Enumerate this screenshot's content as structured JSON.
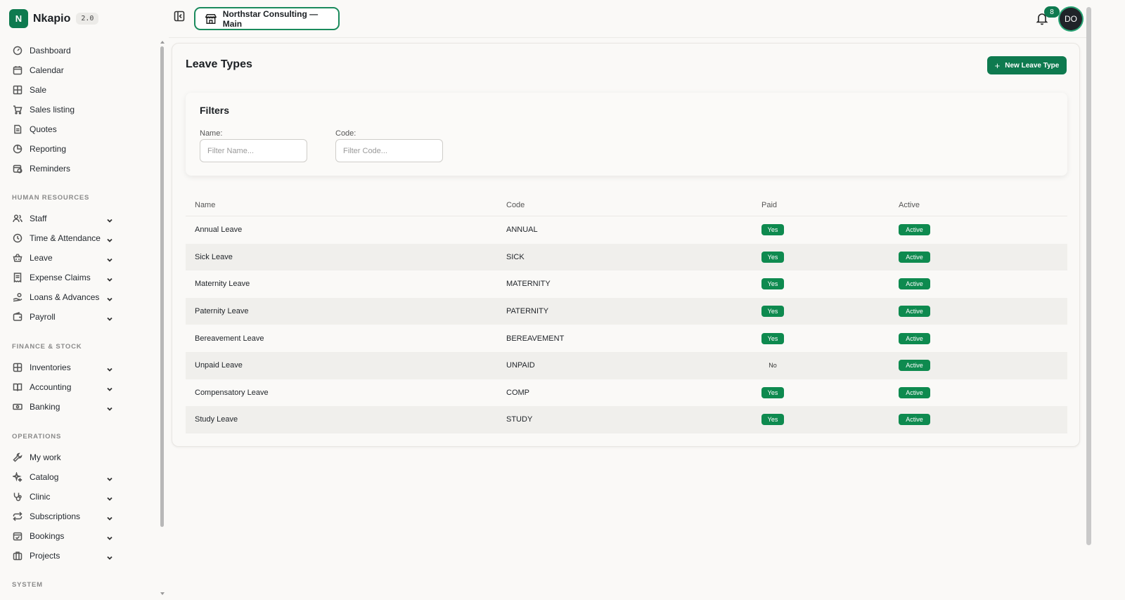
{
  "brand": {
    "logo_letter": "N",
    "name": "Nkapio",
    "version": "2.0"
  },
  "sidebar": {
    "top_items": [
      {
        "label": "Dashboard",
        "icon": "gauge-icon"
      },
      {
        "label": "Calendar",
        "icon": "calendar-icon"
      },
      {
        "label": "Sale",
        "icon": "grid-icon"
      },
      {
        "label": "Sales listing",
        "icon": "cart-icon"
      },
      {
        "label": "Quotes",
        "icon": "document-icon"
      },
      {
        "label": "Reporting",
        "icon": "pie-chart-icon"
      },
      {
        "label": "Reminders",
        "icon": "calendar-clock-icon"
      }
    ],
    "sections": [
      {
        "title": "HUMAN RESOURCES",
        "items": [
          {
            "label": "Staff",
            "icon": "users-icon"
          },
          {
            "label": "Time & Attendance",
            "icon": "clock-icon"
          },
          {
            "label": "Leave",
            "icon": "basket-icon"
          },
          {
            "label": "Expense Claims",
            "icon": "receipt-icon"
          },
          {
            "label": "Loans & Advances",
            "icon": "hand-coins-icon"
          },
          {
            "label": "Payroll",
            "icon": "wallet-icon"
          }
        ]
      },
      {
        "title": "FINANCE & STOCK",
        "items": [
          {
            "label": "Inventories",
            "icon": "box-icon"
          },
          {
            "label": "Accounting",
            "icon": "book-icon"
          },
          {
            "label": "Banking",
            "icon": "banknote-icon"
          }
        ]
      },
      {
        "title": "OPERATIONS",
        "items": [
          {
            "label": "My work",
            "icon": "wrench-icon"
          },
          {
            "label": "Catalog",
            "icon": "sparkles-icon"
          },
          {
            "label": "Clinic",
            "icon": "stethoscope-icon"
          },
          {
            "label": "Subscriptions",
            "icon": "repeat-icon"
          },
          {
            "label": "Bookings",
            "icon": "calendar-check-icon"
          },
          {
            "label": "Projects",
            "icon": "briefcase-icon"
          }
        ]
      },
      {
        "title": "SYSTEM",
        "items": []
      }
    ]
  },
  "topbar": {
    "org_name": "Northstar Consulting — Main",
    "notification_count": "8",
    "avatar_initials": "DO"
  },
  "page": {
    "title": "Leave Types",
    "new_button": "New Leave Type",
    "filters": {
      "title": "Filters",
      "name_label": "Name:",
      "name_placeholder": "Filter Name...",
      "code_label": "Code:",
      "code_placeholder": "Filter Code..."
    },
    "table": {
      "headers": {
        "name": "Name",
        "code": "Code",
        "paid": "Paid",
        "active": "Active"
      },
      "rows": [
        {
          "name": "Annual Leave",
          "code": "ANNUAL",
          "paid": "Yes",
          "active": "Active"
        },
        {
          "name": "Sick Leave",
          "code": "SICK",
          "paid": "Yes",
          "active": "Active"
        },
        {
          "name": "Maternity Leave",
          "code": "MATERNITY",
          "paid": "Yes",
          "active": "Active"
        },
        {
          "name": "Paternity Leave",
          "code": "PATERNITY",
          "paid": "Yes",
          "active": "Active"
        },
        {
          "name": "Bereavement Leave",
          "code": "BEREAVEMENT",
          "paid": "Yes",
          "active": "Active"
        },
        {
          "name": "Unpaid Leave",
          "code": "UNPAID",
          "paid": "No",
          "active": "Active"
        },
        {
          "name": "Compensatory Leave",
          "code": "COMP",
          "paid": "Yes",
          "active": "Active"
        },
        {
          "name": "Study Leave",
          "code": "STUDY",
          "paid": "Yes",
          "active": "Active"
        }
      ]
    }
  },
  "colors": {
    "brand": "#0e7a4f",
    "pill": "#0e8a4f",
    "background": "#faf9f7"
  }
}
